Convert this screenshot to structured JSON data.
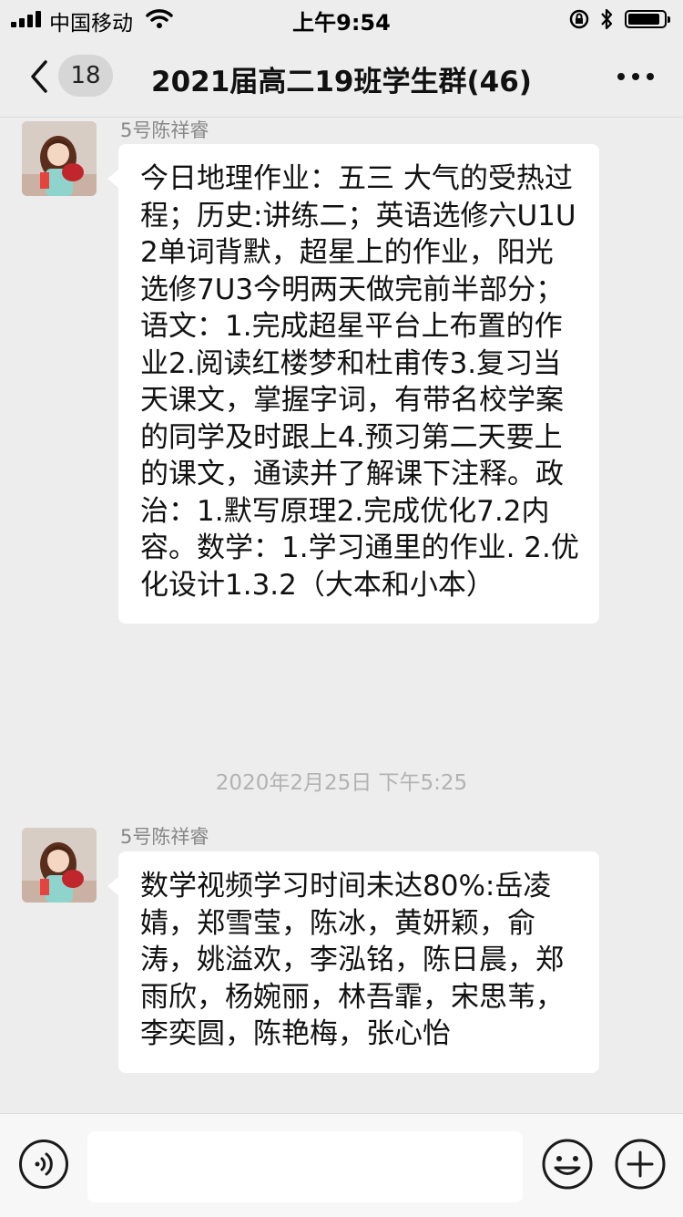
{
  "status_bar": {
    "carrier": "中国移动",
    "time": "上午9:54"
  },
  "nav": {
    "unread_count": "18",
    "chat_title": "2021届高二19班学生群(46)"
  },
  "messages": [
    {
      "sender": "5号陈祥睿",
      "text": "今日地理作业：五三 大气的受热过程；历史:讲练二；英语选修六U1U2单词背默，超星上的作业，阳光选修7U3今明两天做完前半部分；语文：1.完成超星平台上布置的作业2.阅读红楼梦和杜甫传3.复习当天课文，掌握字词，有带名校学案的同学及时跟上4.预习第二天要上的课文，通读并了解课下注释。政治：1.默写原理2.完成优化7.2内容。数学：1.学习通里的作业. 2.优化设计1.3.2（大本和小本）"
    },
    {
      "sender": "5号陈祥睿",
      "text": "数学视频学习时间未达80%:岳凌婧，郑雪莹，陈冰，黄妍颖，俞涛，姚溢欢，李泓铭，陈日晨，郑雨欣，杨婉丽，林吾霏，宋思苇，李奕圆，陈艳梅，张心怡"
    }
  ],
  "timestamp": "2020年2月25日 下午5:25",
  "icons": {
    "back": "chevron-left-icon",
    "more": "more-dots-icon",
    "voice": "voice-input-icon",
    "emoji": "emoji-icon",
    "plus": "plus-icon"
  }
}
